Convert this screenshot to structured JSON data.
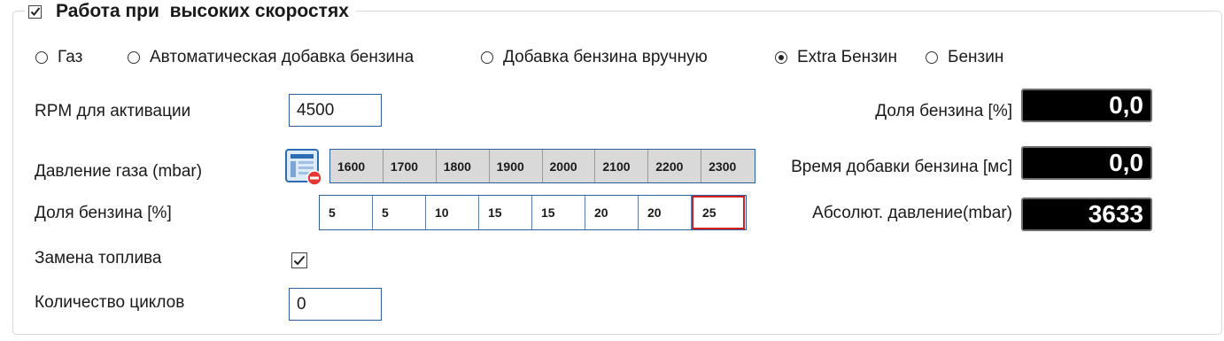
{
  "group": {
    "title": "Работа при  высоких скоростях",
    "enabled": true
  },
  "fuel_mode": {
    "options": [
      {
        "label": "Газ",
        "selected": false
      },
      {
        "label": "Автоматическая добавка бензина",
        "selected": false
      },
      {
        "label": "Добавка бензина вручную",
        "selected": false
      },
      {
        "label": "Extra Бензин",
        "selected": true
      },
      {
        "label": "Бензин",
        "selected": false
      }
    ]
  },
  "params": {
    "rpm_label": "RPM для активации",
    "rpm_value": "4500",
    "gas_pressure_label": "Давление газа (mbar)",
    "petrol_share_label": "Доля бензина [%]",
    "fuel_switch_label": "Замена топлива",
    "fuel_switch_checked": true,
    "cycles_label": "Количество циклов",
    "cycles_value": "0"
  },
  "table": {
    "edit_icon": "table-edit-icon",
    "pressures": [
      "1600",
      "1700",
      "1800",
      "1900",
      "2000",
      "2100",
      "2200",
      "2300"
    ],
    "shares": [
      "5",
      "5",
      "10",
      "15",
      "15",
      "20",
      "20",
      "25"
    ],
    "selected_index": 7
  },
  "readouts": {
    "petrol_share_label": "Доля бензина [%]",
    "petrol_share_value": "0,0",
    "petrol_time_label": "Время добавки бензина [мс]",
    "petrol_time_value": "0,0",
    "abs_pressure_label": "Абсолют. давление(mbar)",
    "abs_pressure_value": "3633"
  },
  "colors": {
    "accent_border": "#2d5f9c",
    "selected_cell": "#d31f1f",
    "remove_badge": "#e53935"
  }
}
